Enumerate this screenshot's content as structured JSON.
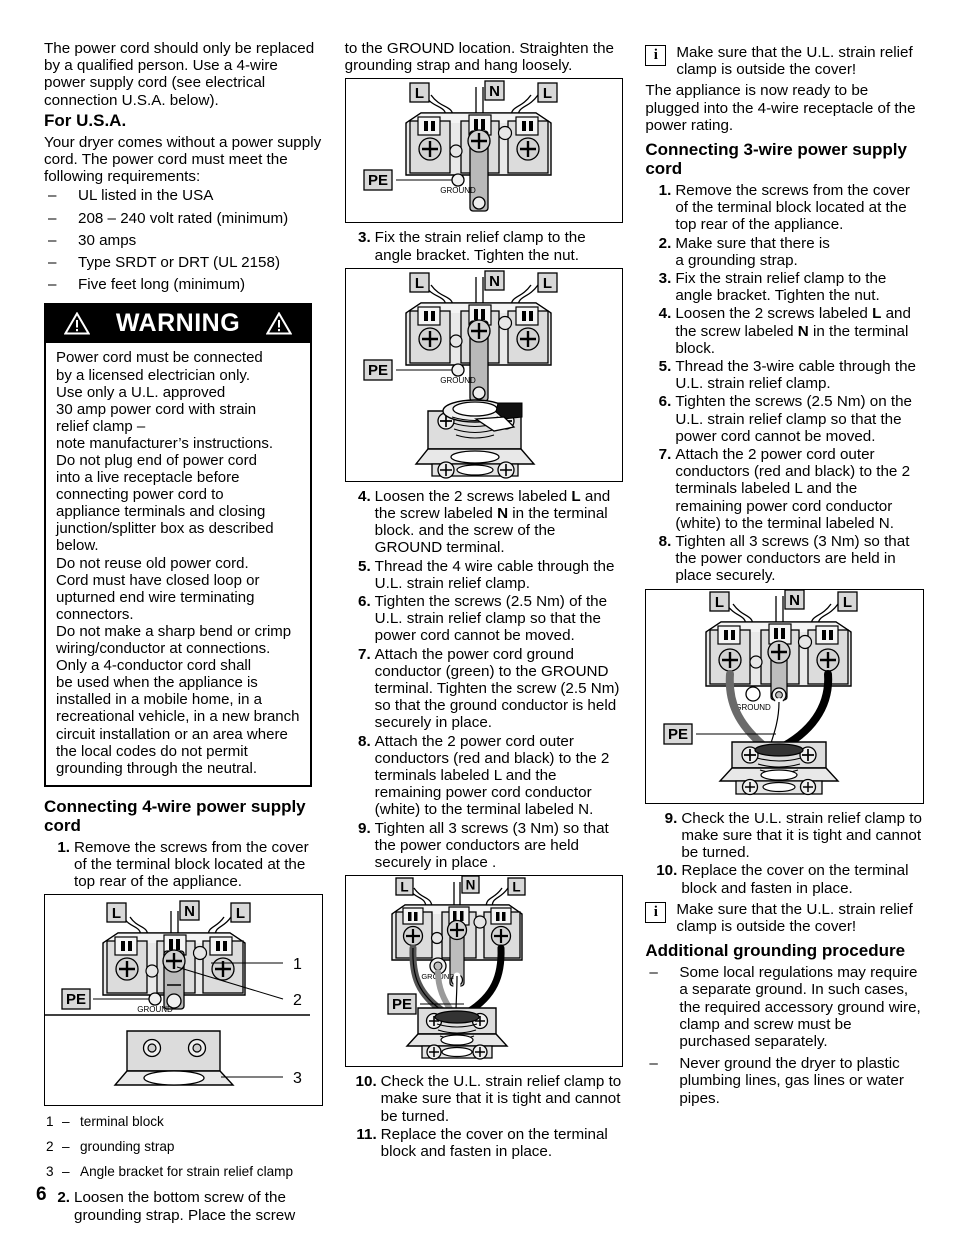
{
  "page": {
    "number": "6"
  },
  "left": {
    "intro": "The power cord should only be replaced by a qualified person. Use a 4-wire power supply cord (see electrical connection U.S.A. below).",
    "usa_heading": "For U.S.A.",
    "usa_intro": "Your dryer comes without a power supply cord. The power cord must meet the following requirements:",
    "requirements": [
      "UL listed in the USA",
      "208 – 240 volt rated (minimum)",
      "30 amps",
      "Type SRDT or DRT (UL 2158)",
      "Five feet long (minimum)"
    ],
    "warning": {
      "title": "WARNING",
      "icon_left": "warning-triangle-icon",
      "icon_right": "warning-triangle-icon",
      "lines": [
        "Power cord must be connected",
        "by a licensed electrician  only.",
        "Use only a U.L. approved",
        "30 amp power cord with strain",
        "relief clamp –",
        "note manufacturer’s instructions.",
        "Do not plug end of power cord",
        "into a live receptacle before",
        "connecting power cord to",
        "appliance terminals and closing",
        "junction/splitter box as described",
        "below.",
        "Do not reuse old power cord.",
        "Cord must have closed loop or",
        "upturned end wire terminating",
        "connectors.",
        "Do not make a sharp bend or crimp",
        "wiring/conductor at connections.",
        "Only a 4-conductor cord shall",
        "be used when the appliance is",
        "installed in a mobile home, in a",
        "recreational vehicle, in a new branch",
        "circuit installation or an area where",
        "the local codes do not permit",
        "grounding through the neutral."
      ]
    },
    "four_wire_heading": "Connecting 4-wire power supply cord",
    "steps": [
      {
        "num": "1.",
        "text": "Remove the screws from the cover of the terminal block located at the top rear of the appliance."
      }
    ],
    "figure1": {
      "name": "terminal-block-with-angle-bracket-figure",
      "labels": {
        "l_left": "L",
        "n": "N",
        "l_right": "L",
        "pe": "PE",
        "ground": "GROUND"
      },
      "callouts": [
        "1",
        "2",
        "3"
      ]
    },
    "legend": [
      {
        "num": "1",
        "dash": "–",
        "text": "terminal block"
      },
      {
        "num": "2",
        "dash": "–",
        "text": "grounding strap"
      },
      {
        "num": "3",
        "dash": "–",
        "text": "Angle bracket for strain relief clamp"
      }
    ],
    "step2": {
      "num": "2.",
      "text": "Loosen the bottom screw of the grounding strap. Place the screw"
    }
  },
  "middle": {
    "continued": "to the GROUND location. Straighten the grounding strap and hang loosely.",
    "figure2": {
      "name": "terminal-block-grounding-strap-figure",
      "labels": {
        "l_left": "L",
        "n": "N",
        "l_right": "L",
        "pe": "PE",
        "ground": "GROUND"
      }
    },
    "step3": {
      "num": "3.",
      "text": "Fix the strain relief clamp to the angle bracket. Tighten the nut."
    },
    "figure3": {
      "name": "terminal-block-strain-relief-clamp-figure",
      "labels": {
        "l_left": "L",
        "n": "N",
        "l_right": "L",
        "pe": "PE",
        "ground": "GROUND"
      }
    },
    "steps": [
      {
        "num": "4.",
        "text_html": "Loosen the 2 screws labeled <b>L</b> and the screw labeled <b>N</b> in the terminal block. and the screw of the GROUND terminal."
      },
      {
        "num": "5.",
        "text_html": "Thread the 4 wire cable through the U.L. strain relief clamp."
      },
      {
        "num": "6.",
        "text_html": "Tighten the screws (2.5 Nm) of the U.L. strain relief clamp so that the power cord cannot be moved."
      },
      {
        "num": "7.",
        "text_html": "Attach the power cord ground conductor (green) to the GROUND terminal. Tighten the screw (2.5 Nm) so that the ground conductor is held securely in place."
      },
      {
        "num": "8.",
        "text_html": "Attach the 2 power cord outer conductors (red and black) to the 2 terminals labeled L and the remaining power cord conductor (white) to the terminal labeled N."
      },
      {
        "num": "9.",
        "text_html": "Tighten all 3 screws (3 Nm) so that the power conductors are held securely in place ."
      }
    ],
    "figure4": {
      "name": "four-wire-cord-connected-figure",
      "labels": {
        "l_left": "L",
        "n": "N",
        "l_right": "L",
        "pe": "PE",
        "ground": "GROUND"
      }
    },
    "steps_end": [
      {
        "num": "10.",
        "text_html": "Check the U.L. strain relief clamp to make sure that it is tight and cannot be turned."
      },
      {
        "num": "11.",
        "text_html": "Replace the cover on the terminal block and fasten in place."
      }
    ]
  },
  "right": {
    "info1": {
      "icon": "info-icon",
      "icon_char": "i",
      "text": "Make sure that the U.L. strain relief clamp is outside the cover!"
    },
    "ready_text": "The appliance is now ready to be plugged into the 4-wire receptacle of the power rating.",
    "three_wire_heading": "Connecting 3-wire power supply cord",
    "steps": [
      {
        "num": "1.",
        "text_html": "Remove the screws from the cover of the terminal block located at the top rear of the appliance."
      },
      {
        "num": "2.",
        "text_html": "Make sure that there is<br>a grounding strap."
      },
      {
        "num": "3.",
        "text_html": "Fix the strain relief clamp to the angle bracket. Tighten the nut."
      },
      {
        "num": "4.",
        "text_html": "Loosen the 2 screws labeled <b>L</b> and the screw labeled <b>N</b> in the terminal block."
      },
      {
        "num": "5.",
        "text_html": "Thread the 3-wire cable through the U.L. strain relief clamp."
      },
      {
        "num": "6.",
        "text_html": "Tighten the screws (2.5 Nm) on the U.L. strain relief clamp so that the power cord cannot be moved."
      },
      {
        "num": "7.",
        "text_html": "Attach the 2 power cord outer conductors (red and black) to the 2 terminals labeled L and the remaining power cord conductor (white) to the terminal labeled N."
      },
      {
        "num": "8.",
        "text_html": "Tighten all 3 screws (3 Nm) so that the power conductors are held in place securely."
      }
    ],
    "figure5": {
      "name": "three-wire-cord-connected-figure",
      "labels": {
        "l_left": "L",
        "n": "N",
        "l_right": "L",
        "pe": "PE",
        "ground": "GROUND"
      }
    },
    "steps_end": [
      {
        "num": "9.",
        "text_html": "Check the U.L. strain relief clamp to make sure that it is tight and cannot be turned."
      },
      {
        "num": "10.",
        "text_html": "Replace the cover on the terminal block and fasten in place."
      }
    ],
    "info2": {
      "icon": "info-icon",
      "icon_char": "i",
      "text": "Make sure that the U.L. strain relief clamp is outside the cover!"
    },
    "grounding_heading": "Additional grounding procedure",
    "grounding_items": [
      "Some local regulations may require a separate ground. In such cases, the required accessory ground wire, clamp and screw must be purchased separately.",
      "Never ground the dryer to plastic plumbing lines, gas lines or water pipes."
    ]
  },
  "colors": {
    "ink": "#000000",
    "paper": "#ffffff",
    "metal_light": "#e8e8e8",
    "metal_mid": "#c9c9c9",
    "metal_dark": "#9a9a9a"
  }
}
